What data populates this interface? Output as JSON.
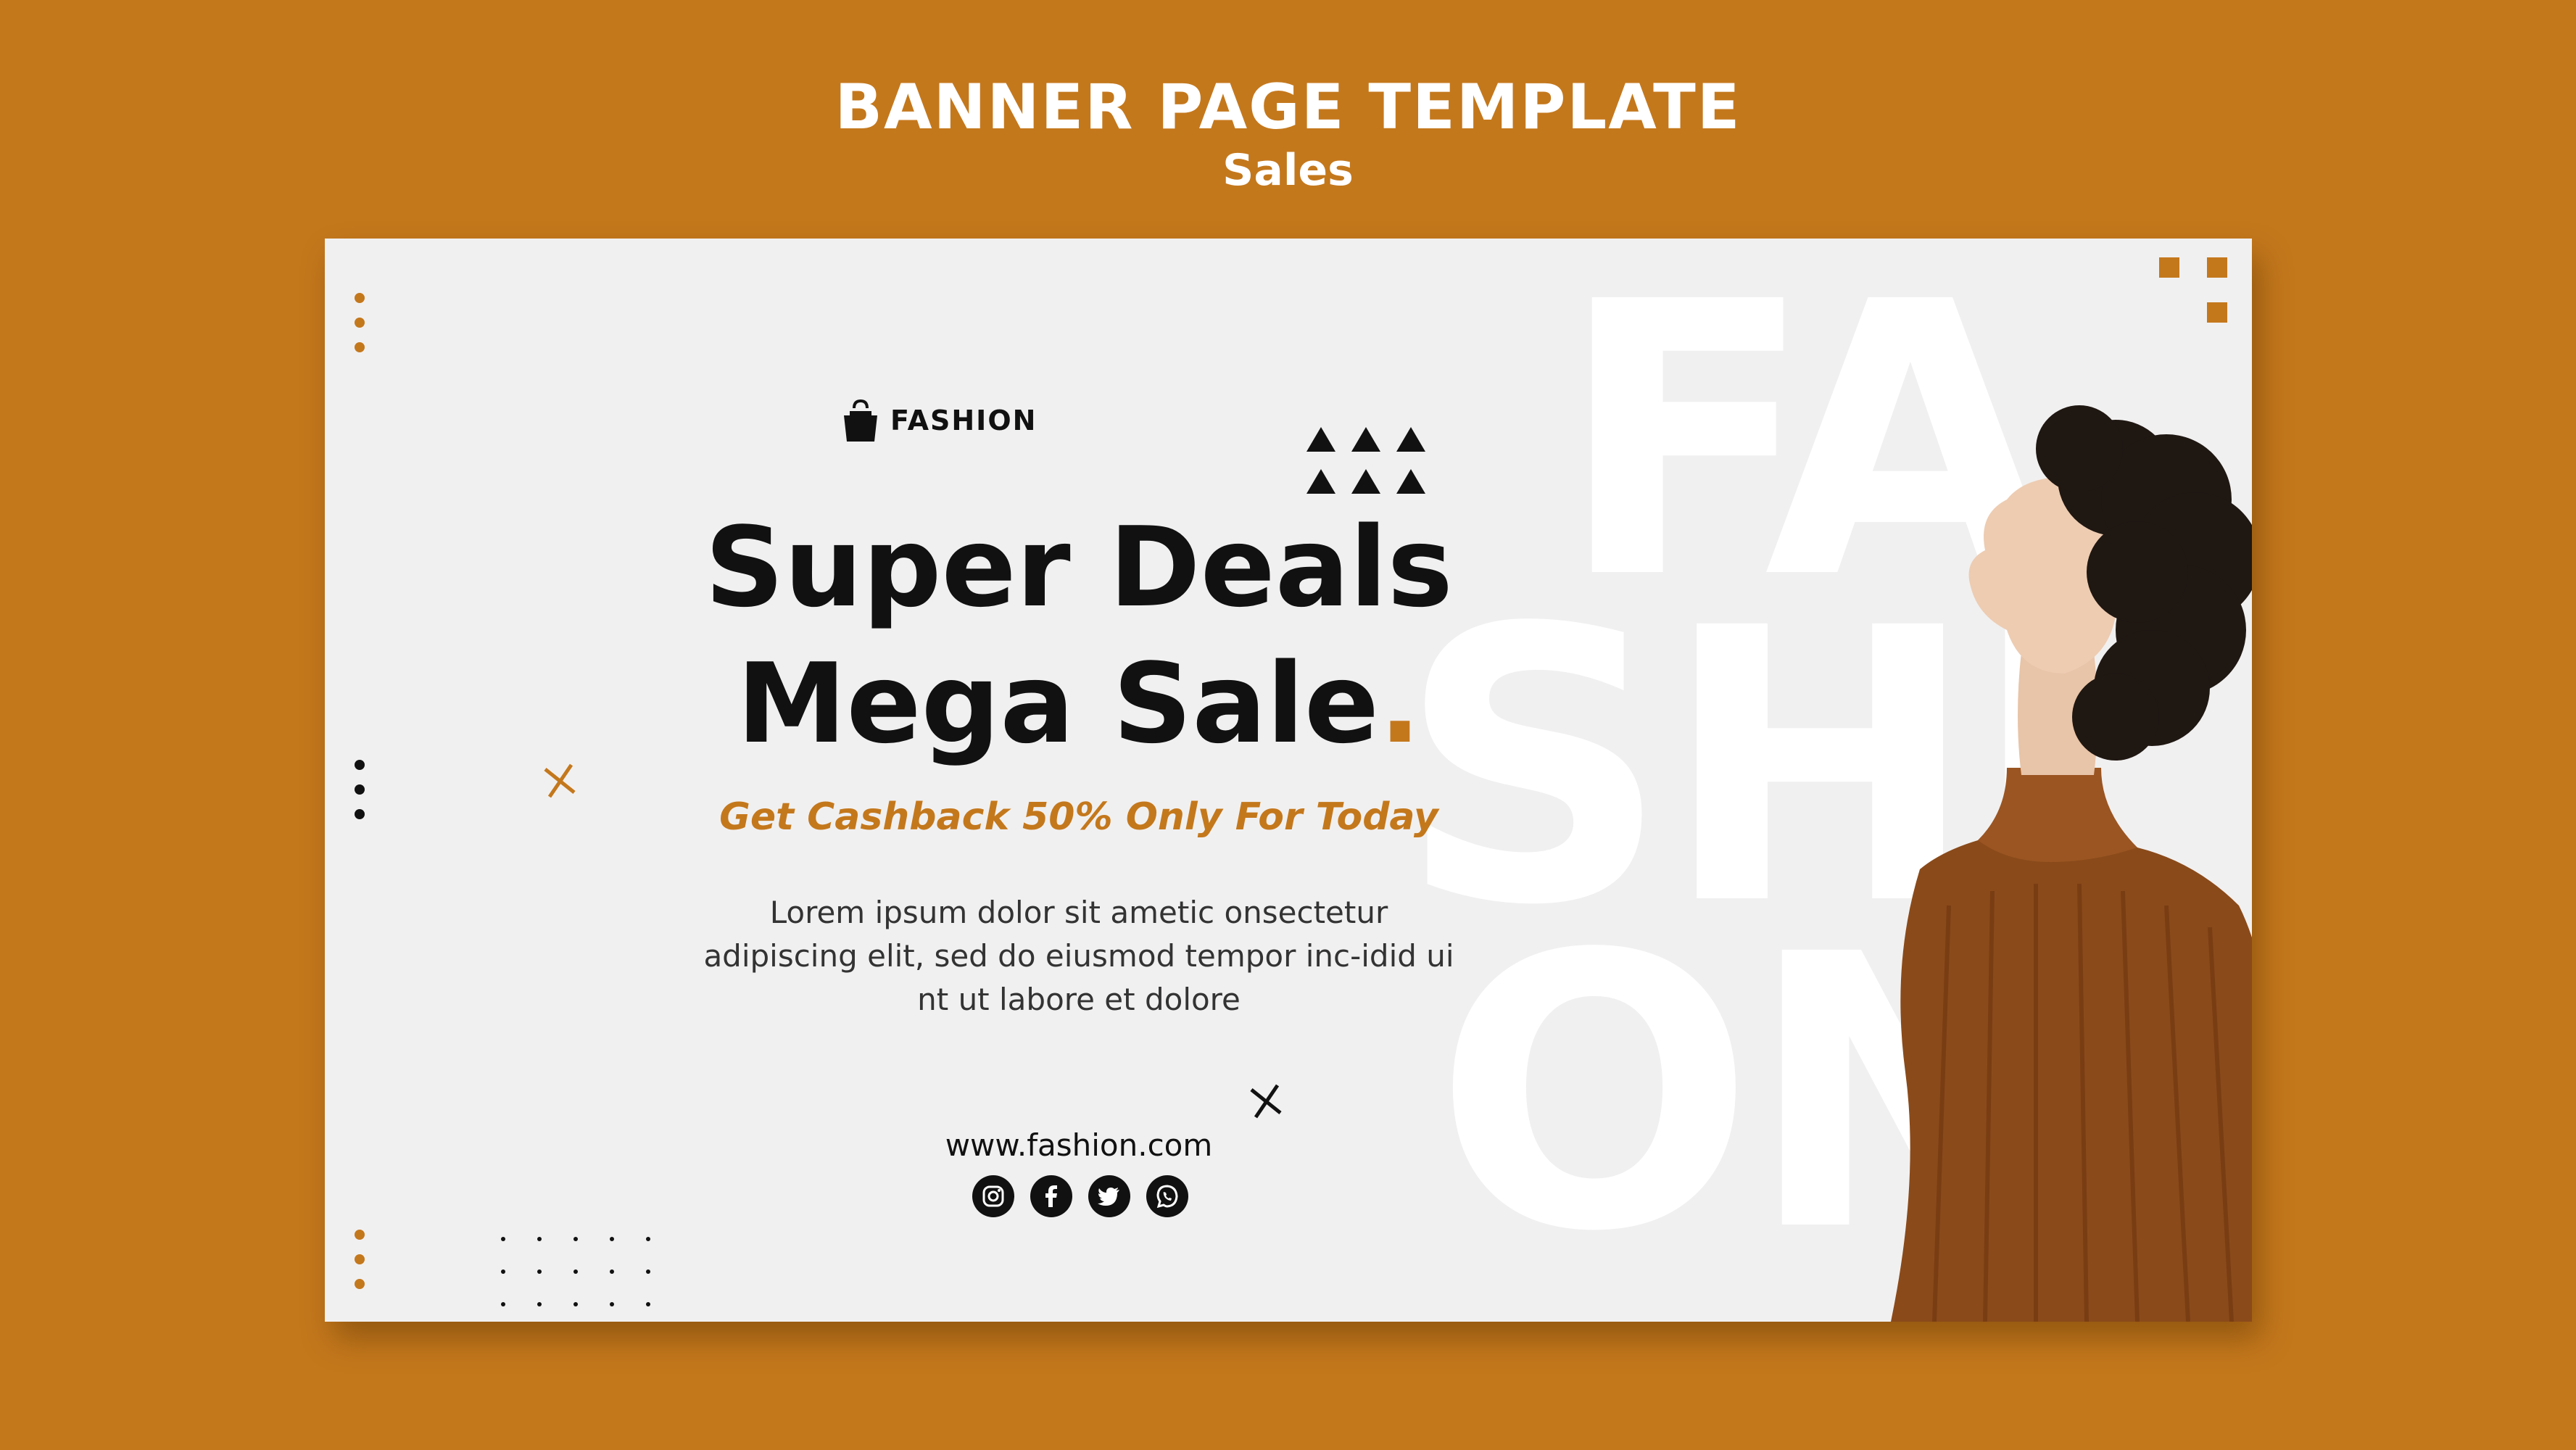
{
  "page": {
    "heading": "BANNER PAGE TEMPLATE",
    "subheading": "Sales"
  },
  "banner": {
    "brand": {
      "icon": "shopping-bag-icon",
      "label": "FASHION"
    },
    "headline_line1": "Super Deals",
    "headline_line2": "Mega Sale",
    "headline_dot": ".",
    "tagline": "Get Cashback 50% Only For Today",
    "body": "Lorem ipsum dolor sit ametic onsectetur adipiscing elit, sed do eiusmod tempor inc-idid ui nt ut labore et dolore",
    "website": "www.fashion.com",
    "socials": [
      "instagram-icon",
      "facebook-icon",
      "twitter-icon",
      "whatsapp-icon"
    ],
    "background_word": [
      "FA",
      "SHI",
      "ON"
    ]
  },
  "colors": {
    "background": "#c4781c",
    "banner": "#f1f0f0",
    "accent": "#c4781c",
    "text": "#111111",
    "background_word": "#ffffff"
  }
}
